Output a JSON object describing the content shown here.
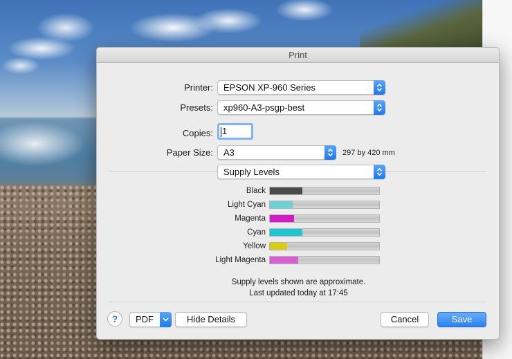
{
  "dialog": {
    "title": "Print",
    "printer": {
      "label": "Printer:",
      "value": "EPSON XP-960 Series"
    },
    "presets": {
      "label": "Presets:",
      "value": "xp960-A3-psgp-best"
    },
    "copies": {
      "label": "Copies:",
      "value": "1"
    },
    "paper_size": {
      "label": "Paper Size:",
      "value": "A3",
      "dimensions": "297 by 420 mm"
    },
    "section": {
      "value": "Supply Levels"
    },
    "supply_levels": [
      {
        "name": "Black",
        "level": 0.3,
        "color": "#4a4a4a"
      },
      {
        "name": "Light Cyan",
        "level": 0.21,
        "color": "#6fd0d8"
      },
      {
        "name": "Magenta",
        "level": 0.22,
        "color": "#d21bc4"
      },
      {
        "name": "Cyan",
        "level": 0.3,
        "color": "#1fc6cf"
      },
      {
        "name": "Yellow",
        "level": 0.16,
        "color": "#d8cc14"
      },
      {
        "name": "Light Magenta",
        "level": 0.26,
        "color": "#d85fcf"
      }
    ],
    "notes": {
      "approximate": "Supply levels shown are approximate.",
      "updated": "Last updated today at 17:45"
    },
    "buttons": {
      "help": "?",
      "pdf": "PDF",
      "hide_details": "Hide Details",
      "cancel": "Cancel",
      "save": "Save"
    }
  }
}
